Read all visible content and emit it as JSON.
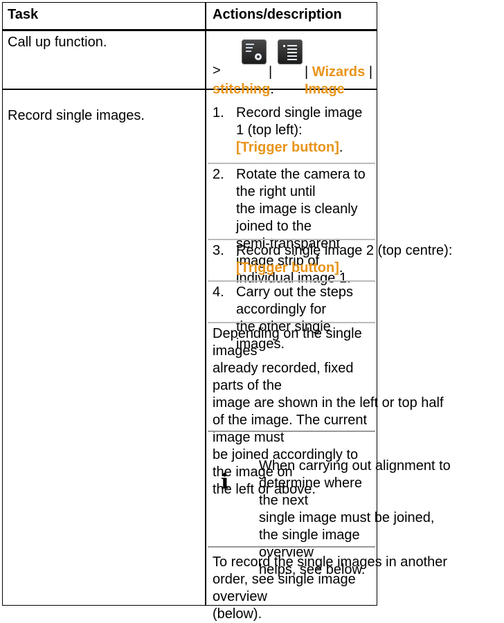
{
  "header": {
    "task": "Task",
    "actions": "Actions/description"
  },
  "row1": {
    "task": "Call up function.",
    "prefix": ">",
    "sep": "|",
    "wizards": "Wizards",
    "image_stitching_1": "Image",
    "image_stitching_2": "stitching",
    "period": ".",
    "icon1_name": "camera-settings-icon",
    "icon2_name": "menu-list-icon"
  },
  "row2": {
    "task": "Record single images.",
    "steps": [
      {
        "num": "1.",
        "lines": [
          "Record single image 1 (top left):"
        ],
        "trigger": "[Trigger button]",
        "end": "."
      },
      {
        "num": "2.",
        "lines": [
          "Rotate the camera to the right until",
          "the image is cleanly joined to the",
          "semi-transparent image strip of",
          "individual image 1."
        ]
      },
      {
        "num": "3.",
        "lines": [
          "Record single image 2 (top centre):"
        ],
        "trigger": "[Trigger button]",
        "end": "."
      },
      {
        "num": "4.",
        "lines": [
          "Carry out the steps accordingly for",
          "the other single images."
        ]
      }
    ],
    "para": [
      "Depending on the single images",
      "already recorded, fixed parts of the",
      "image are shown in the left or top half",
      "of the image. The current image must",
      "be joined accordingly to the image on",
      "the left or above."
    ],
    "note_symbol": "i",
    "note": [
      "When carrying out alignment to",
      "determine where the next",
      "single image must be joined,",
      "the single image overview",
      "helps, see below."
    ],
    "final": [
      "To record the single images in another",
      "order, see single image overview",
      "(below)."
    ]
  }
}
